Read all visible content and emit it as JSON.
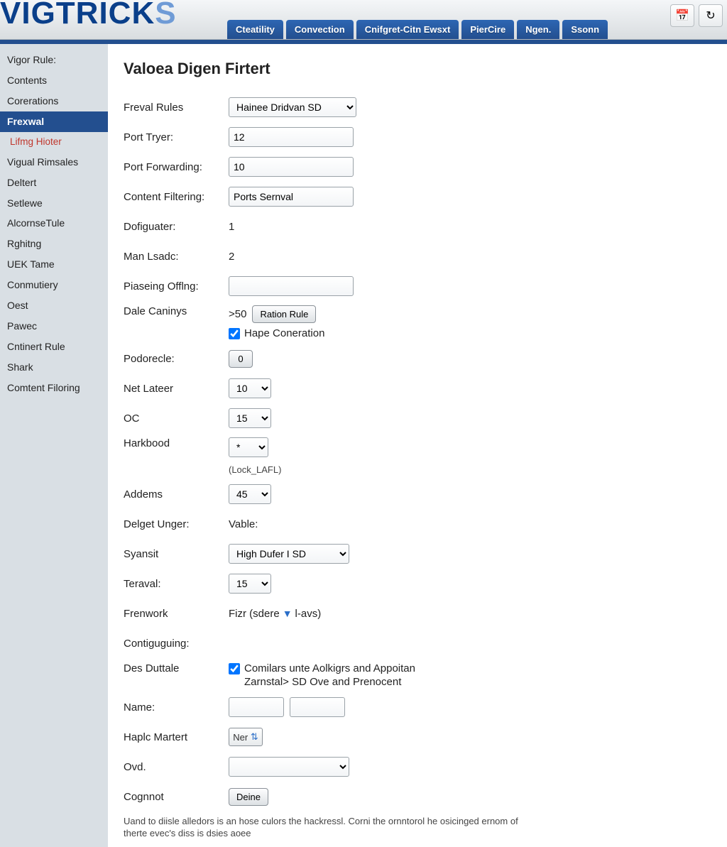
{
  "logo_main": "VIGTRICK",
  "logo_last": "S",
  "header_tabs": [
    "Cteatility",
    "Convection",
    "Cnifgret-Citn Ewsxt",
    "PierCire",
    "Ngen.",
    "Ssonn"
  ],
  "sidebar": [
    "Vigor Rule:",
    "Contents",
    "Corerations",
    "Frexwal",
    "Lifmg Hioter",
    "Vigual Rimsales",
    "Deltert",
    "Setlewe",
    "AlcornseTule",
    "Rghitng",
    "UEK Tame",
    "Conmutiery",
    "Oest",
    "Pawec",
    "Cntinert Rule",
    "Shark",
    "Comtent Filoring"
  ],
  "sidebar_active_index": 3,
  "sidebar_sub_index": 4,
  "page_title": "Valoea Digen Firtert",
  "form": {
    "freval_rules": {
      "label": "Freval Rules",
      "value": "Hainee Dridvan SD"
    },
    "port_tryer": {
      "label": "Port Tryer:",
      "value": "12"
    },
    "port_forwarding": {
      "label": "Port Forwarding:",
      "value": "10"
    },
    "content_filtering": {
      "label": "Content Filtering:",
      "value": "Ports Sernval"
    },
    "dofiguater": {
      "label": "Dofiguater:",
      "value": "1"
    },
    "man_lsadc": {
      "label": "Man Lsadc:",
      "value": "2"
    },
    "piaseing": {
      "label": "Piaseing Offlng:",
      "value": ""
    },
    "dale_caninys": {
      "label": "Dale Caninys",
      "prefix": ">50",
      "button": "Ration Rule",
      "checkbox": "Hape Coneration",
      "checked": true
    },
    "podorecle": {
      "label": "Podorecle:",
      "value": "0"
    },
    "net_lateer": {
      "label": "Net Lateer",
      "value": "10"
    },
    "oc": {
      "label": "OC",
      "value": "15"
    },
    "harkbood": {
      "label": "Harkbood",
      "value": "*",
      "hint": "(Lock_LAFL)"
    },
    "addems": {
      "label": "Addems",
      "value": "45"
    },
    "delget_unger": {
      "label": "Delget Unger:",
      "value": "Vable:"
    },
    "syansit": {
      "label": "Syansit",
      "value": "High Dufer I SD"
    },
    "teraval": {
      "label": "Teraval:",
      "value": "15"
    },
    "frenwork": {
      "label": "Frenwork",
      "pre": "Fizr (sdere",
      "post": "l-avs)"
    },
    "contiguguing": {
      "label": "Contiguguing:"
    },
    "des_duttale": {
      "label": "Des Duttale",
      "checked": true,
      "line1": "Comilars unte Aolkigrs and Appoitan",
      "line2": "Zarnstal> SD Ove and Prenocent"
    },
    "name": {
      "label": "Name:"
    },
    "haplc_martert": {
      "label": "Haplc Martert",
      "value": "Ner"
    },
    "ovd": {
      "label": "Ovd."
    },
    "cognnot": {
      "label": "Cognnot",
      "button": "Deine"
    }
  },
  "footnote": "Uand to diisle alledors is an hose culors the hackressl. Corni the ornntorol he osicinged ernom of therte evec's diss is dsies aoee"
}
